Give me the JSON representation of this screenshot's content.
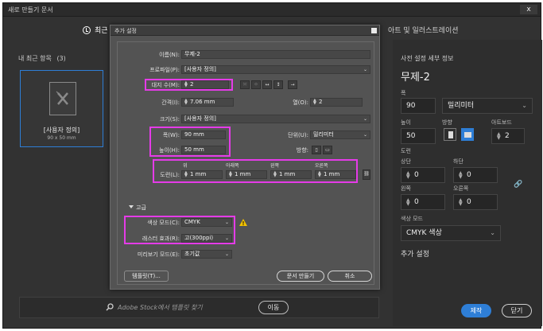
{
  "window": {
    "title": "새로 만들기 문서",
    "close_label": "x"
  },
  "tabs": [
    {
      "label": "최근"
    },
    {
      "label": "아트 및 일러스트레이션"
    }
  ],
  "recent": {
    "header": "내 최근 항목",
    "count": "(3)",
    "card": {
      "name": "[사용자 정의]",
      "size": "90 x 50 mm"
    }
  },
  "search": {
    "placeholder": "Adobe Stock에서 템플릿 찾기",
    "go_label": "이동"
  },
  "preset_panel": {
    "title": "사전 설정 세부 정보",
    "doc_name": "무제-2",
    "width_label": "폭",
    "width_value": "90",
    "unit": "밀리미터",
    "height_label": "높이",
    "height_value": "50",
    "orientation_label": "방향",
    "artboards_label": "아트보드",
    "artboards_value": "2",
    "bleed_label": "도련",
    "top_label": "상단",
    "top_value": "0",
    "bottom_label": "하단",
    "bottom_value": "0",
    "left_label": "왼쪽",
    "left_value": "0",
    "right_label": "오른쪽",
    "right_value": "0",
    "color_mode_label": "색상 모드",
    "color_mode_value": "CMYK 색상",
    "more_settings": "추가 설정",
    "create_label": "제작",
    "close_label": "닫기"
  },
  "dialog": {
    "title": "추가 설정",
    "name_label": "이름(N):",
    "name_value": "무제-2",
    "profile_label": "프로파일(P):",
    "profile_value": "[사용자 정의]",
    "artboards_label": "대지 수(M):",
    "artboards_value": "2",
    "spacing_label": "간격(I):",
    "spacing_value": "7.06 mm",
    "columns_label": "열(O):",
    "columns_value": "2",
    "size_label": "크기(S):",
    "size_value": "[사용자 정의]",
    "width_label": "폭(W):",
    "width_value": "90 mm",
    "units_label": "단위(U):",
    "units_value": "밀리미터",
    "height_label": "높이(H):",
    "height_value": "50 mm",
    "orientation_label": "방향:",
    "bleed_label": "도련(L):",
    "bleed_top_label": "위",
    "bleed_top": "1 mm",
    "bleed_bottom_label": "아래쪽",
    "bleed_bottom": "1 mm",
    "bleed_left_label": "왼쪽",
    "bleed_left": "1 mm",
    "bleed_right_label": "오른쪽",
    "bleed_right": "1 mm",
    "advanced_label": "고급",
    "color_mode_label": "색상 모드(C):",
    "color_mode_value": "CMYK",
    "raster_label": "래스터 효과(R):",
    "raster_value": "고(300ppi)",
    "preview_label": "미리보기 모드(E):",
    "preview_value": "초기값",
    "templates_label": "템플릿(T)...",
    "create_label": "문서 만들기",
    "cancel_label": "취소"
  },
  "colors": {
    "accent": "#2e7ed6",
    "highlight": "#e53be8",
    "warning": "#f2c200"
  }
}
